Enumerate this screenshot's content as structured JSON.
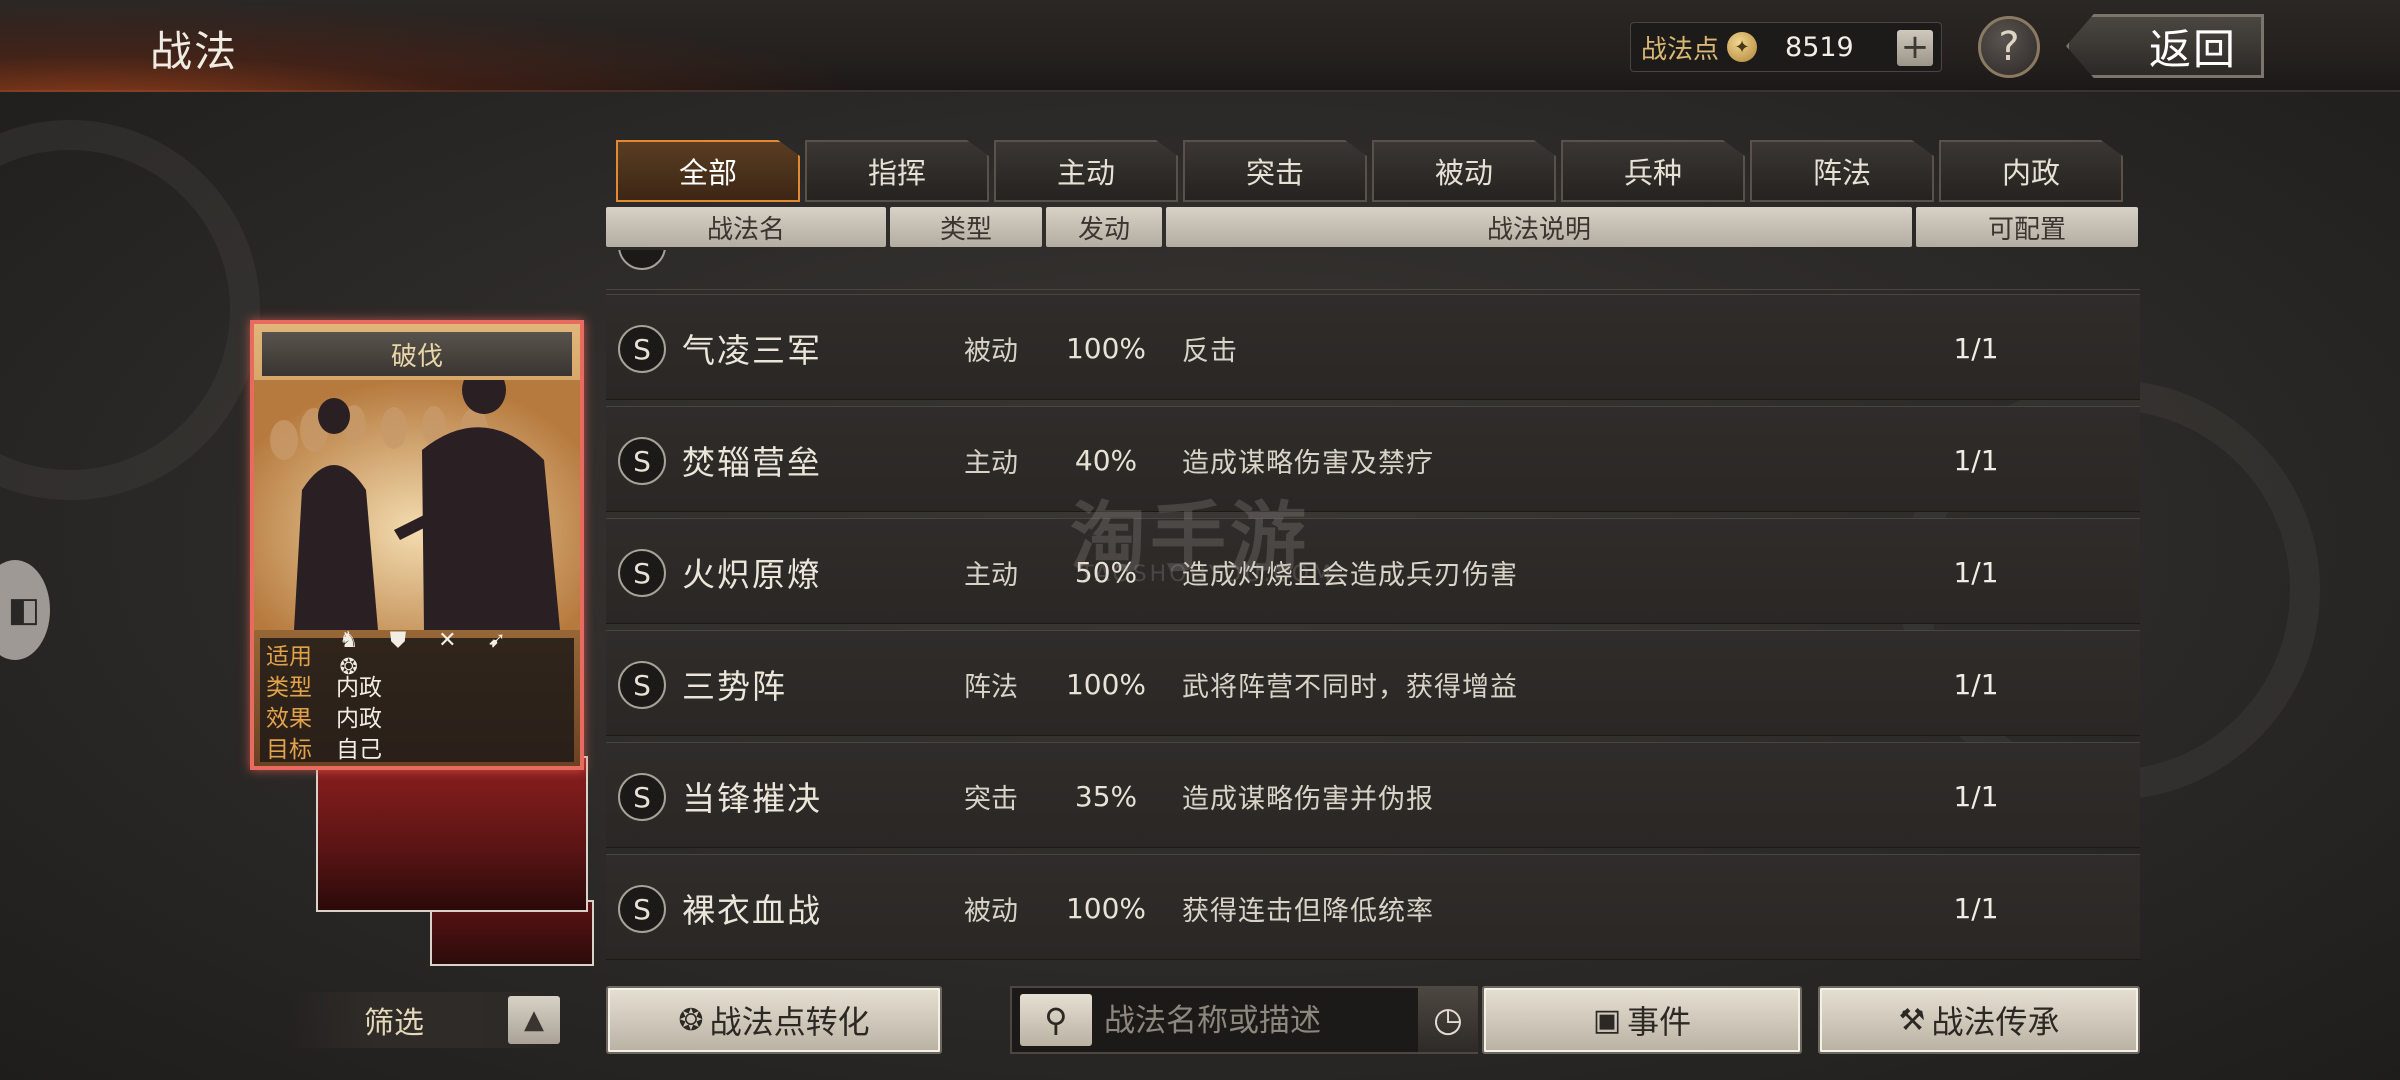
{
  "header": {
    "title": "战法",
    "points_label": "战法点",
    "points_value": "8519",
    "plus_icon": "plus-icon",
    "help_label": "?",
    "back_label": "返回"
  },
  "tabs": [
    {
      "label": "全部",
      "active": true
    },
    {
      "label": "指挥",
      "active": false
    },
    {
      "label": "主动",
      "active": false
    },
    {
      "label": "突击",
      "active": false
    },
    {
      "label": "被动",
      "active": false
    },
    {
      "label": "兵种",
      "active": false
    },
    {
      "label": "阵法",
      "active": false
    },
    {
      "label": "内政",
      "active": false
    }
  ],
  "table_headers": {
    "name": "战法名",
    "type": "类型",
    "trigger": "发动",
    "description": "战法说明",
    "configurable": "可配置"
  },
  "rows": [
    {
      "grade": "S",
      "name": "气凌三军",
      "type": "被动",
      "rate": "100%",
      "desc": "反击",
      "conf": "1/1"
    },
    {
      "grade": "S",
      "name": "焚辎营垒",
      "type": "主动",
      "rate": "40%",
      "desc": "造成谋略伤害及禁疗",
      "conf": "1/1"
    },
    {
      "grade": "S",
      "name": "火炽原燎",
      "type": "主动",
      "rate": "50%",
      "desc": "造成灼烧且会造成兵刃伤害",
      "conf": "1/1"
    },
    {
      "grade": "S",
      "name": "三势阵",
      "type": "阵法",
      "rate": "100%",
      "desc": "武将阵营不同时，获得增益",
      "conf": "1/1"
    },
    {
      "grade": "S",
      "name": "当锋摧决",
      "type": "突击",
      "rate": "35%",
      "desc": "造成谋略伤害并伪报",
      "conf": "1/1"
    },
    {
      "grade": "S",
      "name": "裸衣血战",
      "type": "被动",
      "rate": "100%",
      "desc": "获得连击但降低统率",
      "conf": "1/1"
    }
  ],
  "card": {
    "name": "破伐",
    "info": [
      {
        "key": "适用",
        "value": ""
      },
      {
        "key": "类型",
        "value": "内政"
      },
      {
        "key": "效果",
        "value": "内政"
      },
      {
        "key": "目标",
        "value": "自己"
      }
    ],
    "troop_icons": [
      "cavalry-icon",
      "shield-icon",
      "archer-icon",
      "spear-icon",
      "siege-icon"
    ]
  },
  "watermark": {
    "main": "淘手游",
    "sub": "TAOSHOUYOU.COM"
  },
  "bottom": {
    "filter_label": "筛选",
    "convert_label": "战法点转化",
    "search_placeholder": "战法名称或描述",
    "event_label": "事件",
    "inherit_label": "战法传承"
  },
  "colors": {
    "accent_orange": "#e08a35",
    "card_border": "#e96a5e",
    "gold_text": "#d9b774"
  }
}
